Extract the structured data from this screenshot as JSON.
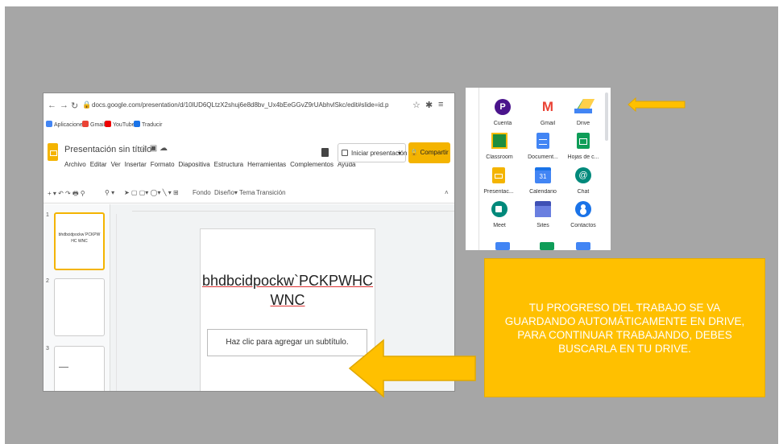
{
  "browser": {
    "url": "docs.google.com/presentation/d/10lUD6QLtzX2shuj6e8d8bv_Ux4bEeGGvZ9rUAbhvlSkc/edit#slide=id.p",
    "bookmarks": [
      "Aplicaciones",
      "Gmail",
      "YouTube",
      "Traducir"
    ]
  },
  "doc": {
    "title": "Presentación sin título",
    "menu": [
      "Archivo",
      "Editar",
      "Ver",
      "Insertar",
      "Formato",
      "Diapositiva",
      "Estructura",
      "Herramientas",
      "Complementos",
      "Ayuda"
    ],
    "present_label": "Iniciar presentación",
    "share_label": "Compartir",
    "toolbar": [
      "Fondo",
      "Diseño▾",
      "Tema",
      "Transición"
    ]
  },
  "filmstrip": {
    "numbers": [
      "1",
      "2",
      "3"
    ],
    "thumb1_text": "bhdbcidpockw`PCKPWHC WNC"
  },
  "slide": {
    "title_line1": "bhdbcidpockw`PCKPWHC",
    "title_line2": "WNC",
    "subtitle_placeholder": "Haz clic para agregar un subtítulo."
  },
  "apps": {
    "items": [
      {
        "label": "Cuenta",
        "icon": "account-icon"
      },
      {
        "label": "Gmail",
        "icon": "gmail-icon"
      },
      {
        "label": "Drive",
        "icon": "drive-icon"
      },
      {
        "label": "Classroom",
        "icon": "classroom-icon"
      },
      {
        "label": "Document...",
        "icon": "docs-icon"
      },
      {
        "label": "Hojas de c...",
        "icon": "sheets-icon"
      },
      {
        "label": "Presentac...",
        "icon": "slides-icon"
      },
      {
        "label": "Calendario",
        "icon": "calendar-icon"
      },
      {
        "label": "Chat",
        "icon": "chat-icon"
      },
      {
        "label": "Meet",
        "icon": "meet-icon"
      },
      {
        "label": "Sites",
        "icon": "sites-icon"
      },
      {
        "label": "Contactos",
        "icon": "contacts-icon"
      }
    ],
    "cuenta_letter": "P",
    "calendar_day": "31"
  },
  "info": {
    "text": "TU PROGRESO DEL TRABAJO SE VA GUARDANDO AUTOMÁTICAMENTE EN DRIVE, PARA CONTINUAR TRABAJANDO, DEBES BUSCARLA EN TU DRIVE."
  },
  "colors": {
    "background": "#a6a6a6",
    "accent": "#ffc000",
    "slides_yellow": "#f4b400"
  }
}
